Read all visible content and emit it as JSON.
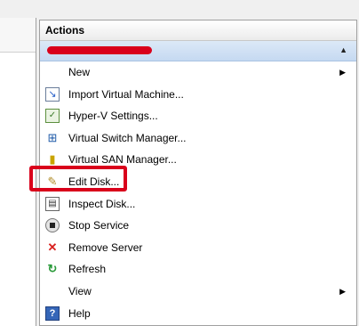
{
  "actions_panel": {
    "title": "Actions",
    "section": {
      "redacted": true,
      "collapse_icon": "triangle-up"
    }
  },
  "items": [
    {
      "label": "New",
      "icon": "",
      "submenu": true
    },
    {
      "label": "Import Virtual Machine...",
      "icon": "import-vm"
    },
    {
      "label": "Hyper-V Settings...",
      "icon": "hyperv-settings"
    },
    {
      "label": "Virtual Switch Manager...",
      "icon": "switch-manager"
    },
    {
      "label": "Virtual SAN Manager...",
      "icon": "san-manager"
    },
    {
      "label": "Edit Disk...",
      "icon": "edit-disk",
      "highlighted": true
    },
    {
      "label": "Inspect Disk...",
      "icon": "inspect-disk"
    },
    {
      "label": "Stop Service",
      "icon": "stop-service"
    },
    {
      "label": "Remove Server",
      "icon": "remove-server"
    },
    {
      "label": "Refresh",
      "icon": "refresh"
    },
    {
      "label": "View",
      "icon": "",
      "submenu": true
    },
    {
      "label": "Help",
      "icon": "help"
    }
  ],
  "colors": {
    "highlight": "#d9001b",
    "redaction": "#d9001b",
    "section_header": "#c5d9f1"
  }
}
